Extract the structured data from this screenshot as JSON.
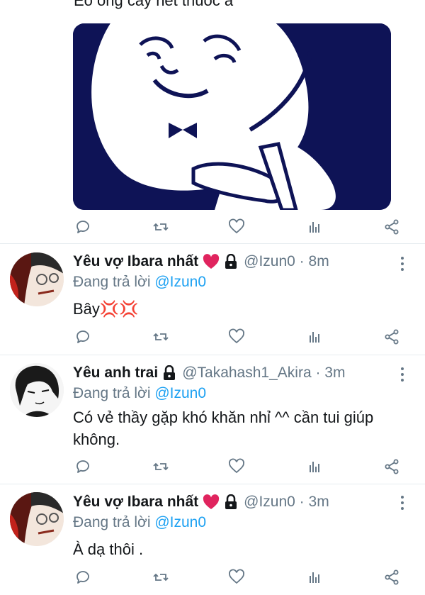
{
  "top_tweet": {
    "text": "Eo ông cầy hết thuốc à"
  },
  "action_icons": [
    "reply-icon",
    "retweet-icon",
    "like-icon",
    "analytics-icon",
    "share-icon"
  ],
  "replies": [
    {
      "name": "Yêu vợ Ibara nhất",
      "has_heart": true,
      "handle": "@Izun0 · 8m",
      "reply_label": "Đang trả lời",
      "reply_to": "@Izun0",
      "text": "Bây💢💢"
    },
    {
      "name": "Yêu anh trai",
      "has_heart": false,
      "handle": "@Takahash1_Akira · 3m",
      "reply_label": "Đang trả lời",
      "reply_to": "@Izun0",
      "text": "Có vẻ thầy gặp khó khăn nhỉ ^^ cần tui giúp không."
    },
    {
      "name": "Yêu vợ Ibara nhất",
      "has_heart": true,
      "handle": "@Izun0 · 3m",
      "reply_label": "Đang trả lời",
      "reply_to": "@Izun0",
      "text": "À dạ thôi ."
    }
  ],
  "colors": {
    "link": "#1da1f2",
    "muted": "#657786",
    "media_background": "#0e1356",
    "heart": "#e0245e"
  }
}
